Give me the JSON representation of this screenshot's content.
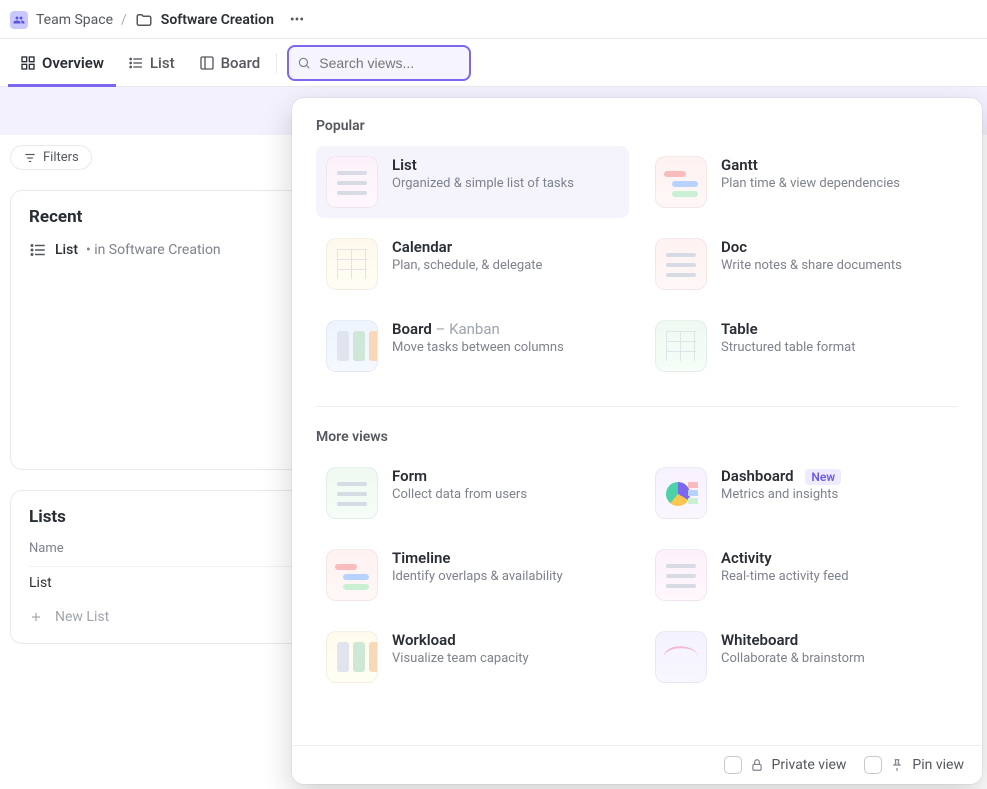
{
  "breadcrumb": {
    "space": "Team Space",
    "folder": "Software Creation"
  },
  "viewTabs": {
    "overview": "Overview",
    "list": "List",
    "board": "Board"
  },
  "search": {
    "placeholder": "Search views..."
  },
  "filters": {
    "label": "Filters"
  },
  "recent": {
    "heading": "Recent",
    "item": {
      "name": "List",
      "meta": "• in Software Creation"
    }
  },
  "lists": {
    "heading": "Lists",
    "col": "Name",
    "row0": "List",
    "new": "New List"
  },
  "dropdown": {
    "section1": "Popular",
    "section2": "More views",
    "items": {
      "list": {
        "title": "List",
        "desc": "Organized & simple list of tasks"
      },
      "gantt": {
        "title": "Gantt",
        "desc": "Plan time & view dependencies"
      },
      "calendar": {
        "title": "Calendar",
        "desc": "Plan, schedule, & delegate"
      },
      "doc": {
        "title": "Doc",
        "desc": "Write notes & share documents"
      },
      "board": {
        "title": "Board",
        "subtitle": "– Kanban",
        "desc": "Move tasks between columns"
      },
      "table": {
        "title": "Table",
        "desc": "Structured table format"
      },
      "form": {
        "title": "Form",
        "desc": "Collect data from users"
      },
      "dashboard": {
        "title": "Dashboard",
        "badge": "New",
        "desc": "Metrics and insights"
      },
      "timeline": {
        "title": "Timeline",
        "desc": "Identify overlaps & availability"
      },
      "activity": {
        "title": "Activity",
        "desc": "Real-time activity feed"
      },
      "workload": {
        "title": "Workload",
        "desc": "Visualize team capacity"
      },
      "whiteboard": {
        "title": "Whiteboard",
        "desc": "Collaborate & brainstorm"
      }
    },
    "footer": {
      "private": "Private view",
      "pin": "Pin view"
    }
  }
}
